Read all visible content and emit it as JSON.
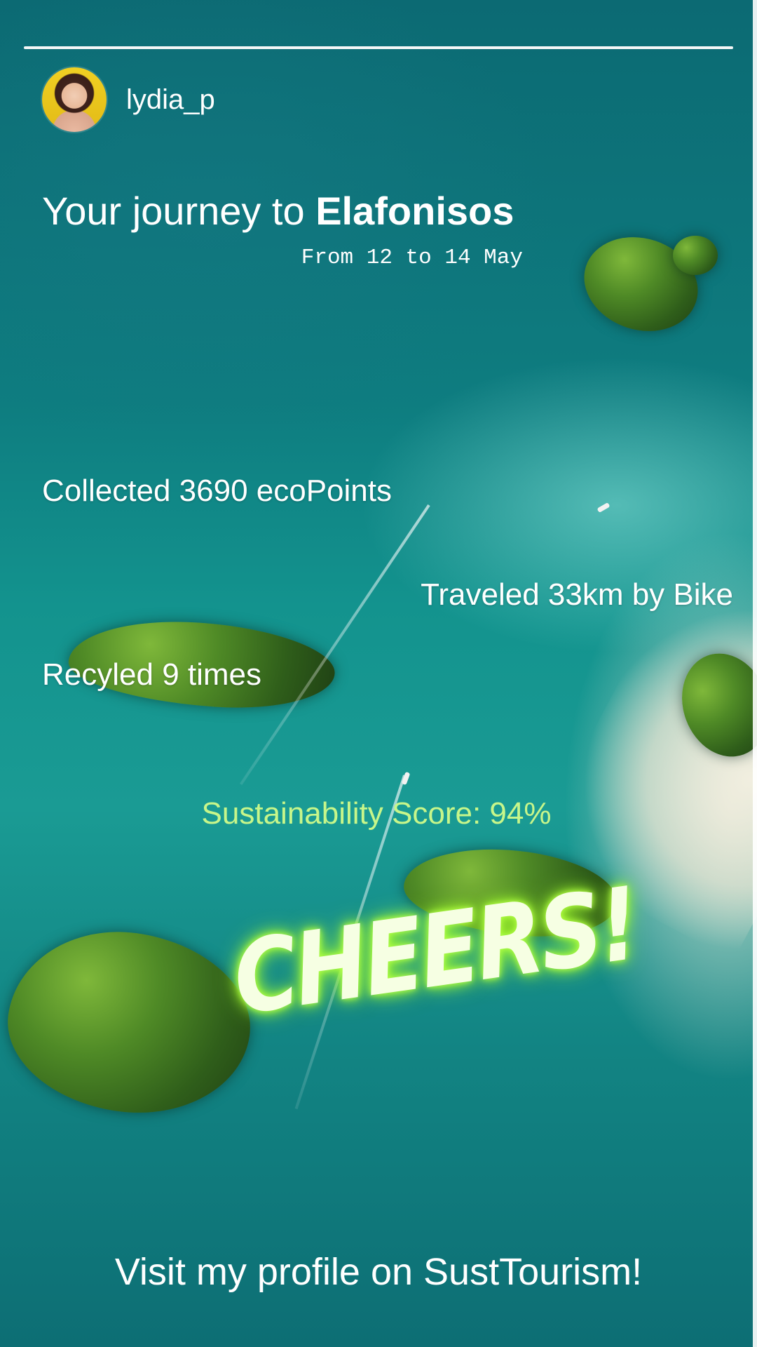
{
  "profile": {
    "username": "lydia_p"
  },
  "journey": {
    "prefix": "Your journey to ",
    "destination": "Elafonisos",
    "dates": "From 12 to 14 May"
  },
  "stats": {
    "ecopoints": "Collected 3690 ecoPoints",
    "bike": "Traveled 33km by Bike",
    "recycled": "Recyled 9 times"
  },
  "score": {
    "label": "Sustainability Score: 94%",
    "color": "#c7f68a"
  },
  "cheers": {
    "text": "CHEERS!",
    "glow_color": "#a6ff2e"
  },
  "cta": {
    "text": "Visit my profile on SustTourism!"
  },
  "icons": {
    "avatar": "user-avatar-photo"
  }
}
